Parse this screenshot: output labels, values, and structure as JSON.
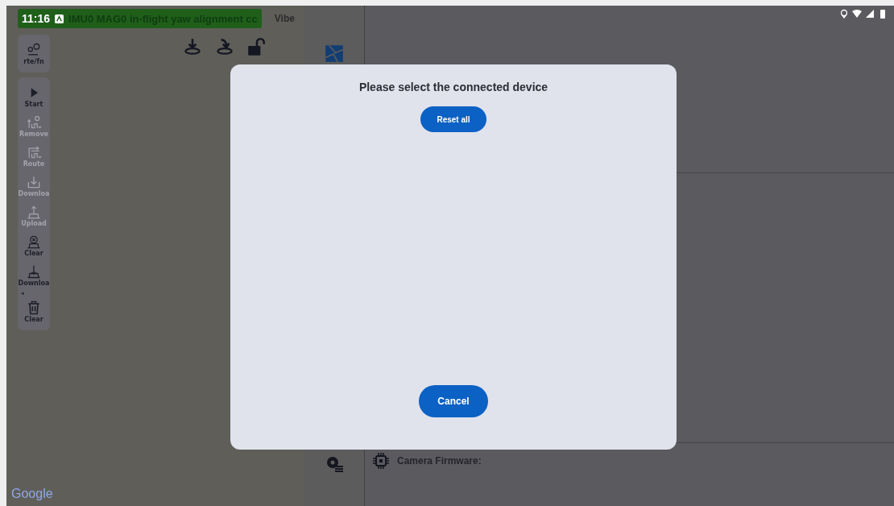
{
  "status_bar": {
    "time": "11:16"
  },
  "banner": {
    "text": "IMU0 MAG0 in-flight yaw alignment cc"
  },
  "banner_tab": "Vibe",
  "mode_button": {
    "label": "rte/fn"
  },
  "toolbar": [
    {
      "kind": "play",
      "label": "Start",
      "disabled": false
    },
    {
      "kind": "remove",
      "label": "Remove",
      "disabled": true
    },
    {
      "kind": "route",
      "label": "Route",
      "disabled": true
    },
    {
      "kind": "download",
      "label": "Downloa",
      "disabled": true
    },
    {
      "kind": "upload",
      "label": "Upload",
      "disabled": true
    },
    {
      "kind": "clear",
      "label": "Clear",
      "disabled": false
    },
    {
      "kind": "download2",
      "label": "Downloa",
      "disabled": false
    },
    {
      "kind": "trash",
      "label": "Clear",
      "disabled": false
    }
  ],
  "collapse_marker": "◂",
  "map_attribution": "Google",
  "firmware_section": {
    "label": "Camera Firmware:"
  },
  "dialog": {
    "title": "Please select the connected device",
    "reset_button": "Reset all",
    "cancel_button": "Cancel"
  }
}
